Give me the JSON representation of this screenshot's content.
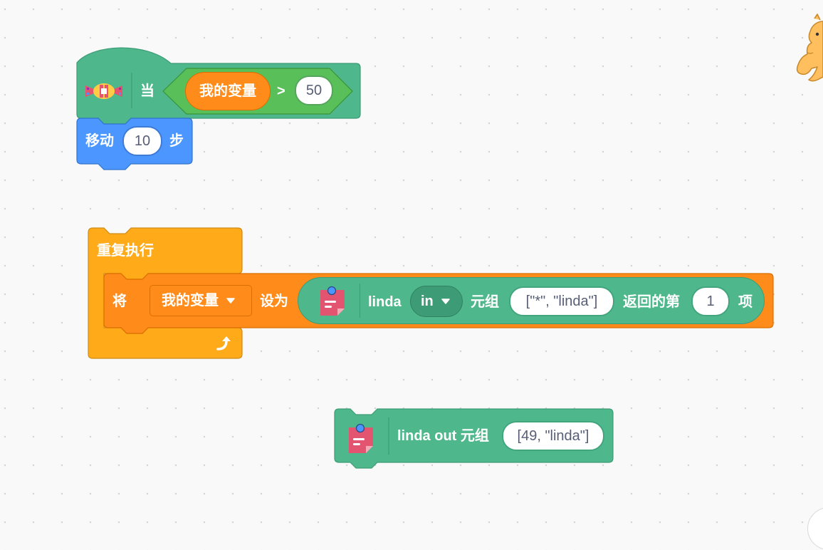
{
  "colors": {
    "extension": "#4eb88c",
    "extension_dark": "#3d9c76",
    "operator": "#59c059",
    "variable": "#ff8c1a",
    "motion": "#4c97ff",
    "control": "#ffab19",
    "icon_pink": "#e2546f"
  },
  "hat_block": {
    "icon": "candy-icon",
    "when_label": "当",
    "condition": {
      "variable": "我的变量",
      "operator": ">",
      "value": "50"
    }
  },
  "move_block": {
    "label": "移动",
    "steps": "10",
    "unit": "步"
  },
  "forever_block": {
    "label": "重复执行",
    "loop_icon": "loop-arrow-icon",
    "set_block": {
      "label_set": "将",
      "variable_dropdown": "我的变量",
      "label_to": "设为",
      "reporter": {
        "icon": "sticky-note-icon",
        "label_linda": "linda",
        "mode_dropdown": "in",
        "label_tuple": "元组",
        "tuple_value": "[\"*\", \"linda\"]",
        "label_return": "返回的第",
        "index": "1",
        "label_item": "项"
      }
    }
  },
  "linda_out_block": {
    "icon": "sticky-note-icon",
    "label": "linda out 元组",
    "tuple_value": "[49, \"linda\"]"
  }
}
